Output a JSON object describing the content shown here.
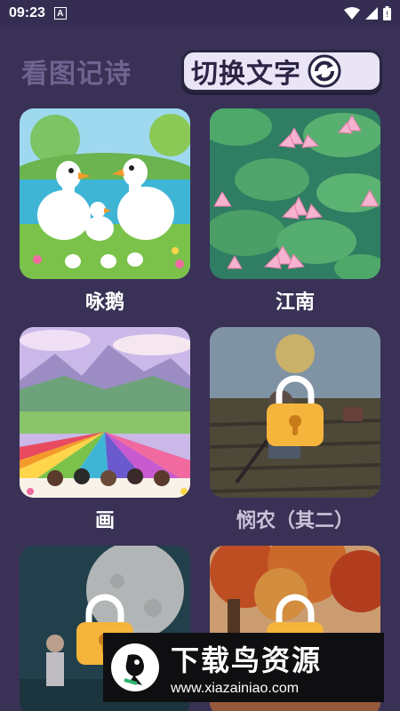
{
  "status": {
    "time": "09:23",
    "notification_letter": "A"
  },
  "header": {
    "title": "看图记诗",
    "switch_label": "切换文字"
  },
  "colors": {
    "background": "#3a3156",
    "lock_body": "#f5b43c",
    "locked_text": "#c9c3d9"
  },
  "poems": [
    {
      "title": "咏鹅",
      "locked": false,
      "image": "geese-by-lake"
    },
    {
      "title": "江南",
      "locked": false,
      "image": "lotus-pond"
    },
    {
      "title": "画",
      "locked": false,
      "image": "colorful-landscape"
    },
    {
      "title": "悯农（其二）",
      "locked": true,
      "image": "farmer-in-field"
    },
    {
      "title": "",
      "locked": true,
      "image": "child-moon-night"
    },
    {
      "title": "",
      "locked": true,
      "image": "autumn-tree"
    }
  ],
  "watermark": {
    "title": "下载鸟资源",
    "url": "www.xiazainiao.com"
  }
}
